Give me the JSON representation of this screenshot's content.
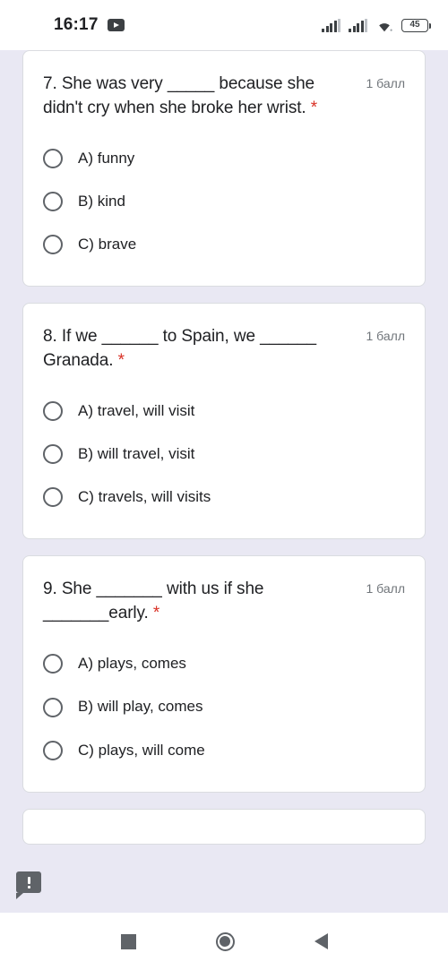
{
  "status_bar": {
    "time": "16:17",
    "notification_icon": "youtube-icon",
    "signal_1_icon": "cellular-signal-icon",
    "signal_2_icon": "cellular-signal-icon",
    "wifi_icon": "wifi-icon",
    "battery_level": "45"
  },
  "form": {
    "questions": [
      {
        "text": "7. She was very _____ because she didn't cry when she broke her wrist.",
        "required_marker": "*",
        "points": "1 балл",
        "options": [
          {
            "label": "A) funny",
            "selected": false
          },
          {
            "label": "B) kind",
            "selected": false
          },
          {
            "label": "C) brave",
            "selected": false
          }
        ]
      },
      {
        "text": "8. If we ______ to Spain, we ______ Granada.",
        "required_marker": "*",
        "points": "1 балл",
        "options": [
          {
            "label": "A) travel, will visit",
            "selected": false
          },
          {
            "label": "B) will travel, visit",
            "selected": false
          },
          {
            "label": "C) travels, will visits",
            "selected": false
          }
        ]
      },
      {
        "text": "9. She _______ with us if she _______early.",
        "required_marker": "*",
        "points": "1 балл",
        "options": [
          {
            "label": "A) plays, comes",
            "selected": false
          },
          {
            "label": "B) will play, comes",
            "selected": false
          },
          {
            "label": "C) plays, will come",
            "selected": false
          }
        ]
      }
    ]
  },
  "comment_badge": {
    "icon": "comment-alert-icon"
  },
  "nav_bar": {
    "recents_icon": "square-recents-icon",
    "home_icon": "circle-home-icon",
    "back_icon": "triangle-back-icon"
  },
  "colors": {
    "page_background": "#e9e8f3",
    "card_background": "#ffffff",
    "required_asterisk": "#d93025",
    "text_primary": "#202124",
    "text_secondary": "#70757a"
  }
}
